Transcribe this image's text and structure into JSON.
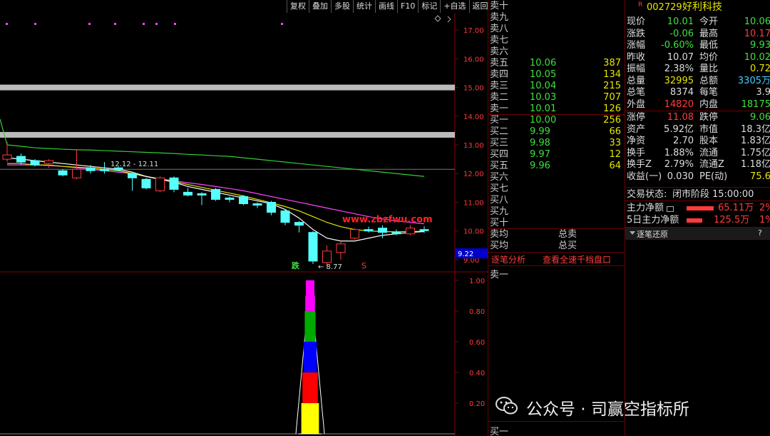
{
  "toolbar": [
    {
      "label": "复权"
    },
    {
      "label": "叠加"
    },
    {
      "label": "多股"
    },
    {
      "label": "统计"
    },
    {
      "label": "画线"
    },
    {
      "label": "F10"
    },
    {
      "label": "标记"
    },
    {
      "label": "+自选"
    },
    {
      "label": "返回"
    }
  ],
  "chart": {
    "price_ticks": [
      "17.00",
      "16.00",
      "15.00",
      "14.00",
      "13.00",
      "12.00",
      "11.00",
      "10.00",
      "9.00"
    ],
    "lower_ticks": [
      "1.00",
      "0.80",
      "0.60",
      "0.40",
      "0.20"
    ],
    "range_label": "12.12 - 12.11",
    "low_label": "8.77",
    "current_price": "9.22",
    "watermark": "www.zbzfwu.com",
    "signal_down": "跌",
    "signal_s": "S",
    "colors": {
      "up": "#ff3b3b",
      "down": "#55ffff",
      "ma5": "#ffffff",
      "ma10": "#e6e600",
      "ma20": "#ff44ff",
      "ma60": "#33cc33",
      "watermark": "#ff2222"
    }
  },
  "orderbook": {
    "asks": [
      {
        "label": "卖十",
        "price": "",
        "vol": ""
      },
      {
        "label": "卖九",
        "price": "",
        "vol": ""
      },
      {
        "label": "卖八",
        "price": "",
        "vol": ""
      },
      {
        "label": "卖七",
        "price": "",
        "vol": ""
      },
      {
        "label": "卖六",
        "price": "",
        "vol": ""
      },
      {
        "label": "卖五",
        "price": "10.06",
        "vol": "387"
      },
      {
        "label": "卖四",
        "price": "10.05",
        "vol": "134"
      },
      {
        "label": "卖三",
        "price": "10.04",
        "vol": "215"
      },
      {
        "label": "卖二",
        "price": "10.03",
        "vol": "707"
      },
      {
        "label": "卖一",
        "price": "10.01",
        "vol": "126"
      }
    ],
    "bids": [
      {
        "label": "买一",
        "price": "10.00",
        "vol": "256"
      },
      {
        "label": "买二",
        "price": "9.99",
        "vol": "66"
      },
      {
        "label": "买三",
        "price": "9.98",
        "vol": "33"
      },
      {
        "label": "买四",
        "price": "9.97",
        "vol": "12"
      },
      {
        "label": "买五",
        "price": "9.96",
        "vol": "64"
      },
      {
        "label": "买六",
        "price": "",
        "vol": ""
      },
      {
        "label": "买七",
        "price": "",
        "vol": ""
      },
      {
        "label": "买八",
        "price": "",
        "vol": ""
      },
      {
        "label": "买九",
        "price": "",
        "vol": ""
      },
      {
        "label": "买十",
        "price": "",
        "vol": ""
      }
    ],
    "avg_sell_label": "卖均",
    "total_sell_label": "总卖",
    "avg_buy_label": "买均",
    "total_buy_label": "总买",
    "tab_tick": "逐笔分析",
    "tab_full": "查看全速千档盘口",
    "bottom_ask": "卖一",
    "bottom_bid": "买一"
  },
  "info": {
    "code_prefix": "R",
    "code": "002729",
    "name": "好利科技",
    "rows": [
      {
        "l1": "现价",
        "v1": "10.01",
        "l2": "今开",
        "v2": "10.06"
      },
      {
        "l1": "涨跌",
        "v1": "-0.06",
        "l2": "最高",
        "v2": "10.17"
      },
      {
        "l1": "涨幅",
        "v1": "-0.60%",
        "l2": "最低",
        "v2": "9.93"
      },
      {
        "l1": "昨收",
        "v1": "10.07",
        "l2": "均价",
        "v2": "10.02"
      },
      {
        "l1": "振幅",
        "v1": "2.38%",
        "l2": "量比",
        "v2": "0.72"
      },
      {
        "l1": "总量",
        "v1": "32995",
        "l2": "总额",
        "v2": "3305万"
      },
      {
        "l1": "总笔",
        "v1": "8374",
        "l2": "每笔",
        "v2": "3.9"
      },
      {
        "l1": "外盘",
        "v1": "14820",
        "l2": "内盘",
        "v2": "18175"
      },
      {
        "l1": "涨停",
        "v1": "11.08",
        "l2": "跌停",
        "v2": "9.06"
      },
      {
        "l1": "资产",
        "v1": "5.92亿",
        "l2": "市值",
        "v2": "18.3亿"
      },
      {
        "l1": "净资",
        "v1": "2.70",
        "l2": "股本",
        "v2": "1.83亿"
      },
      {
        "l1": "换手",
        "v1": "1.88%",
        "l2": "流通",
        "v2": "1.75亿"
      },
      {
        "l1": "换手Z",
        "v1": "2.79%",
        "l2": "流通Z",
        "v2": "1.18亿"
      },
      {
        "l1": "收益(一)",
        "v1": "0.030",
        "l2": "PE(动)",
        "v2": "75.6"
      }
    ],
    "status_label": "交易状态:",
    "status_value": "闭市阶段",
    "status_time": "15:00:00",
    "flow1_label": "主力净额",
    "flow1_value": "65.11万",
    "flow1_pct": "2%",
    "flow2_label": "5日主力净额",
    "flow2_value": "125.5万",
    "flow2_pct": "1%",
    "panel_title": "逐笔还原",
    "panel_q": "?"
  },
  "footer": {
    "wechat": "公众号 · 司赢空指标所"
  },
  "chart_data": {
    "type": "candlestick",
    "candles": [
      {
        "o": 12.5,
        "c": 12.65,
        "h": 13.1,
        "l": 12.4
      },
      {
        "o": 12.6,
        "c": 12.4,
        "h": 12.7,
        "l": 12.3
      },
      {
        "o": 12.45,
        "c": 12.3,
        "h": 12.5,
        "l": 12.25
      },
      {
        "o": 12.35,
        "c": 12.45,
        "h": 12.5,
        "l": 12.2
      },
      {
        "o": 12.1,
        "c": 11.95,
        "h": 12.15,
        "l": 11.9
      },
      {
        "o": 11.85,
        "c": 12.15,
        "h": 12.85,
        "l": 11.8
      },
      {
        "o": 12.2,
        "c": 12.1,
        "h": 12.3,
        "l": 12.0
      },
      {
        "o": 12.15,
        "c": 12.1,
        "h": 12.4,
        "l": 12.0
      },
      {
        "o": 12.2,
        "c": 12.12,
        "h": 12.25,
        "l": 12.1
      },
      {
        "o": 12.0,
        "c": 11.85,
        "h": 12.05,
        "l": 11.4
      },
      {
        "o": 11.8,
        "c": 11.5,
        "h": 11.85,
        "l": 11.45
      },
      {
        "o": 11.4,
        "c": 11.85,
        "h": 11.9,
        "l": 11.35
      },
      {
        "o": 11.85,
        "c": 11.45,
        "h": 11.9,
        "l": 11.35
      },
      {
        "o": 11.35,
        "c": 11.25,
        "h": 11.5,
        "l": 11.2
      },
      {
        "o": 11.3,
        "c": 11.25,
        "h": 11.35,
        "l": 10.9
      },
      {
        "o": 11.45,
        "c": 11.1,
        "h": 11.5,
        "l": 11.05
      },
      {
        "o": 11.15,
        "c": 11.1,
        "h": 11.2,
        "l": 11.0
      },
      {
        "o": 11.2,
        "c": 10.95,
        "h": 11.25,
        "l": 10.9
      },
      {
        "o": 10.95,
        "c": 10.9,
        "h": 11.0,
        "l": 10.8
      },
      {
        "o": 11.0,
        "c": 10.65,
        "h": 11.05,
        "l": 10.55
      },
      {
        "o": 10.7,
        "c": 10.3,
        "h": 10.75,
        "l": 10.2
      },
      {
        "o": 10.3,
        "c": 10.2,
        "h": 10.35,
        "l": 9.95
      },
      {
        "o": 9.95,
        "c": 8.95,
        "h": 10.0,
        "l": 8.85
      },
      {
        "o": 8.9,
        "c": 9.3,
        "h": 9.5,
        "l": 8.77
      },
      {
        "o": 9.25,
        "c": 9.55,
        "h": 9.65,
        "l": 9.0
      },
      {
        "o": 9.75,
        "c": 10.05,
        "h": 10.1,
        "l": 9.7
      },
      {
        "o": 10.05,
        "c": 10.0,
        "h": 10.15,
        "l": 9.95
      },
      {
        "o": 10.1,
        "c": 9.95,
        "h": 10.2,
        "l": 9.75
      },
      {
        "o": 9.95,
        "c": 9.9,
        "h": 10.05,
        "l": 9.85
      },
      {
        "o": 9.9,
        "c": 10.1,
        "h": 10.2,
        "l": 9.85
      },
      {
        "o": 10.05,
        "c": 10.01,
        "h": 10.17,
        "l": 9.93
      }
    ],
    "ylim": [
      8.6,
      17.6
    ],
    "hlines": [
      15.0,
      13.35,
      12.15
    ],
    "ma_white": [
      12.55,
      12.5,
      12.45,
      12.4,
      12.35,
      12.3,
      12.25,
      12.2,
      12.15,
      12.05,
      11.9,
      11.8,
      11.7,
      11.55,
      11.45,
      11.35,
      11.25,
      11.15,
      11.05,
      10.95,
      10.75,
      10.45,
      10.05,
      9.75,
      9.65,
      9.65,
      9.75,
      9.85,
      9.9,
      9.95,
      9.98
    ],
    "ma_yellow": [
      12.35,
      12.35,
      12.3,
      12.3,
      12.25,
      12.22,
      12.2,
      12.15,
      12.1,
      12.0,
      11.9,
      11.8,
      11.72,
      11.62,
      11.52,
      11.42,
      11.32,
      11.22,
      11.1,
      10.98,
      10.85,
      10.7,
      10.5,
      10.3,
      10.15,
      10.05,
      10.0,
      9.98,
      9.97,
      9.98,
      9.99
    ],
    "ma_magenta": [
      12.3,
      12.3,
      12.3,
      12.28,
      12.25,
      12.2,
      12.15,
      12.1,
      12.05,
      12.0,
      11.9,
      11.82,
      11.75,
      11.68,
      11.62,
      11.55,
      11.48,
      11.4,
      11.3,
      11.2,
      11.1,
      11.0,
      10.9,
      10.8,
      10.7,
      10.6,
      10.5,
      10.42,
      10.35,
      10.3,
      10.25
    ],
    "ma_green": [
      13.0,
      12.95,
      12.9,
      12.87,
      12.85,
      12.83,
      12.82,
      12.8,
      12.78,
      12.76,
      12.74,
      12.72,
      12.7,
      12.67,
      12.65,
      12.62,
      12.6,
      12.55,
      12.5,
      12.45,
      12.4,
      12.35,
      12.3,
      12.25,
      12.2,
      12.15,
      12.1,
      12.05,
      12.0,
      11.95,
      11.9
    ],
    "lower": {
      "ylim": [
        0,
        1.05
      ],
      "spike_value": 1.0,
      "segments": [
        0.2,
        0.4,
        0.6,
        0.8,
        0.9,
        1.0
      ]
    }
  }
}
